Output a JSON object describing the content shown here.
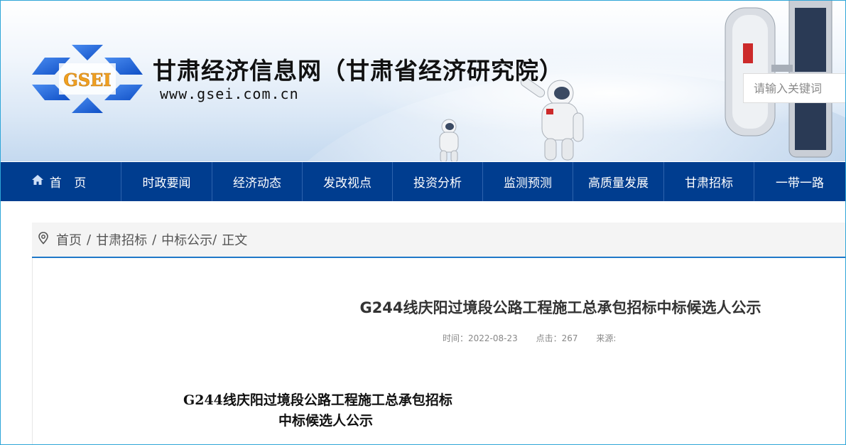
{
  "header": {
    "logo_text": "GSEI",
    "site_title": "甘肃经济信息网（甘肃省经济研究院）",
    "site_url": "www.gsei.com.cn",
    "search_placeholder": "请输入关键词"
  },
  "nav": {
    "items": [
      {
        "label": "首 页",
        "icon": "home-icon"
      },
      {
        "label": "时政要闻"
      },
      {
        "label": "经济动态"
      },
      {
        "label": "发改视点"
      },
      {
        "label": "投资分析"
      },
      {
        "label": "监测预测"
      },
      {
        "label": "高质量发展"
      },
      {
        "label": "甘肃招标"
      },
      {
        "label": "一带一路"
      }
    ]
  },
  "breadcrumb": {
    "icon": "location-pin-icon",
    "items": [
      "首页",
      "甘肃招标",
      "中标公示"
    ],
    "separator": "/",
    "current": "正文"
  },
  "article": {
    "title": "G244线庆阳过境段公路工程施工总承包招标中标候选人公示",
    "time_label": "时间：2022-08-23",
    "clicks_label": "点击：267",
    "source_label": "来源:",
    "body_heading_line1": "G244线庆阳过境段公路工程施工总承包招标",
    "body_heading_line2": "中标候选人公示"
  },
  "colors": {
    "nav_bg": "#003d8f",
    "accent_line": "#1f78c8",
    "logo_blue": "#1a5fd6",
    "logo_text": "#f0a020"
  }
}
